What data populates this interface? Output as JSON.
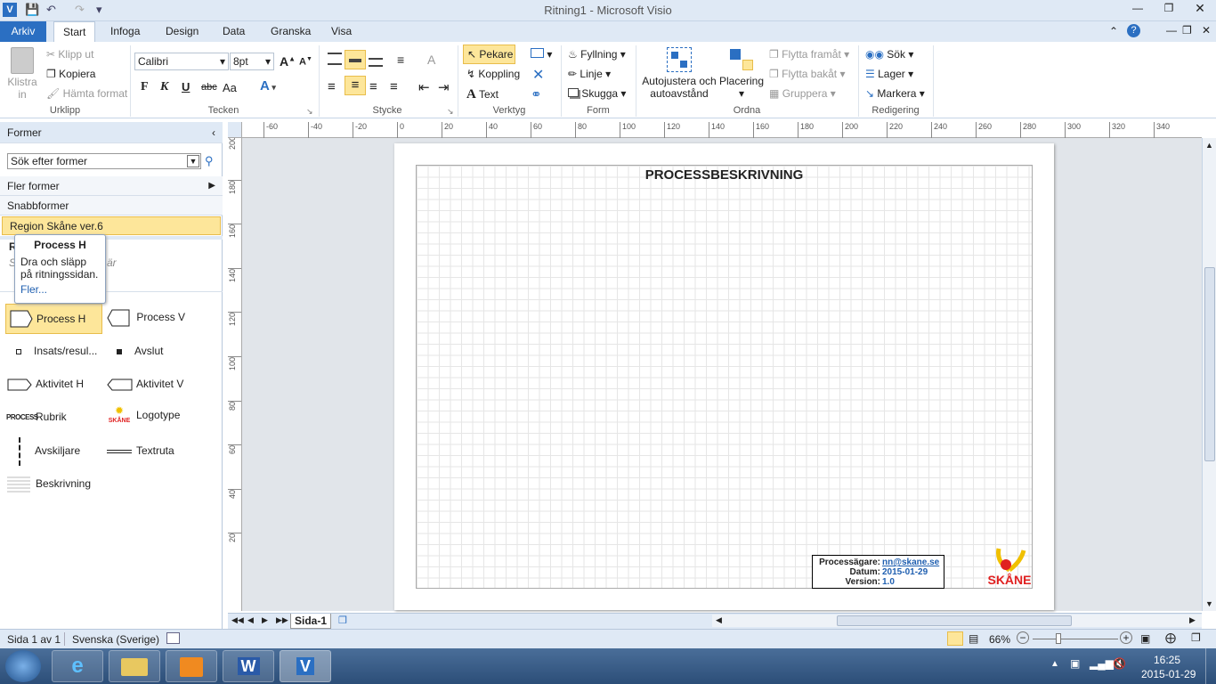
{
  "window": {
    "title": "Ritning1  -  Microsoft Visio"
  },
  "tabs": [
    "Arkiv",
    "Start",
    "Infoga",
    "Design",
    "Data",
    "Granska",
    "Visa"
  ],
  "ribbon": {
    "clipboard": {
      "paste": "Klistra",
      "paste2": "in",
      "cut": "Klipp ut",
      "copy": "Kopiera",
      "format_painter": "Hämta format",
      "group": "Urklipp"
    },
    "font": {
      "name": "Calibri",
      "size": "8pt",
      "group": "Tecken",
      "bold": "F",
      "italic": "K",
      "underline": "U",
      "strike": "abc",
      "case": "Aa"
    },
    "paragraph": {
      "group": "Stycke"
    },
    "tools": {
      "pointer": "Pekare",
      "connector": "Koppling",
      "text": "Text",
      "group": "Verktyg"
    },
    "shape": {
      "fill": "Fyllning",
      "line": "Linje",
      "shadow": "Skugga",
      "group": "Form"
    },
    "arrange": {
      "auto_align": "Autojustera och",
      "auto_align2": "autoavstånd",
      "position": "Placering",
      "bring_forward": "Flytta framåt",
      "send_backward": "Flytta bakåt",
      "group_btn": "Gruppera",
      "group": "Ordna"
    },
    "editing": {
      "find": "Sök",
      "layers": "Lager",
      "select": "Markera",
      "group": "Redigering"
    }
  },
  "ruler": {
    "h_ticks": [
      "-60",
      "-40",
      "-20",
      "0",
      "20",
      "40",
      "60",
      "80",
      "100",
      "120",
      "140",
      "160",
      "180",
      "200",
      "220",
      "240",
      "260",
      "280",
      "300",
      "320",
      "340"
    ],
    "v_ticks": [
      "200",
      "180",
      "160",
      "140",
      "120",
      "100",
      "80",
      "60",
      "40",
      "20"
    ]
  },
  "shapes_panel": {
    "header": "Former",
    "search_placeholder": "Sök efter former",
    "more_shapes": "Fler former",
    "quick_shapes": "Snabbformer",
    "stencil": "Region Skåne ver.6",
    "partial_title": "R",
    "partial_hint": "S",
    "partial_hint_end": "är",
    "tooltip": {
      "title": "Process H",
      "text": "Dra och släpp på ritningssidan.",
      "more": "Fler..."
    },
    "items": [
      {
        "label": "Process H",
        "icon": "process-h-icon"
      },
      {
        "label": "Process V",
        "icon": "process-v-icon"
      },
      {
        "label": "Insats/resul...",
        "icon": "small-square-icon"
      },
      {
        "label": "Avslut",
        "icon": "filled-square-icon"
      },
      {
        "label": "Aktivitet H",
        "icon": "activity-h-icon"
      },
      {
        "label": "Aktivitet V",
        "icon": "activity-v-icon"
      },
      {
        "label": "Rubrik",
        "icon": "process-text-icon",
        "icon_text": "PROCESS"
      },
      {
        "label": "Logotype",
        "icon": "skane-logo-icon",
        "icon_text": "SKÅNE"
      },
      {
        "label": "Avskiljare",
        "icon": "dashed-line-icon"
      },
      {
        "label": "Textruta",
        "icon": "double-line-icon"
      },
      {
        "label": "Beskrivning",
        "icon": "description-icon"
      }
    ]
  },
  "page": {
    "title": "PROCESSBESKRIVNING",
    "owner_label": "Processägare:",
    "owner_value": "nn@skane.se",
    "date_label": "Datum:",
    "date_value": "2015-01-29",
    "version_label": "Version:",
    "version_value": "1.0",
    "logo_text": "SKÅNE"
  },
  "page_tab": "Sida-1",
  "status": {
    "page": "Sida 1 av 1",
    "language": "Svenska (Sverige)",
    "zoom": "66%"
  },
  "clock": {
    "time": "16:25",
    "date": "2015-01-29"
  },
  "colors": {
    "accent": "#2b6fc2",
    "highlight": "#fde69a",
    "link": "#1f5fb0"
  }
}
